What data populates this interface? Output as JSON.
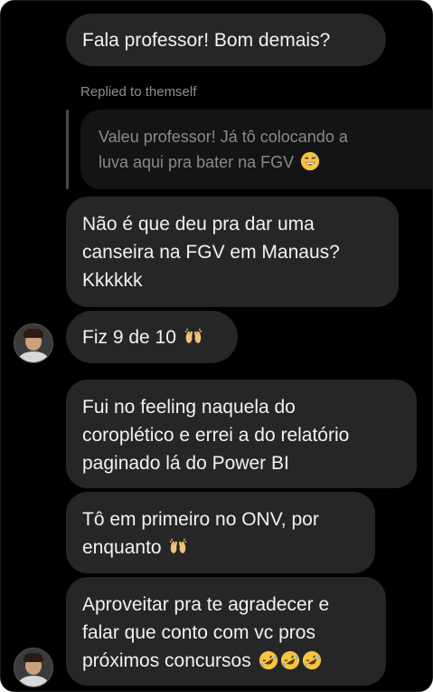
{
  "messages": [
    {
      "id": "m1",
      "lines": [
        "Fala professor! Bom demais?"
      ]
    },
    {
      "id": "reply",
      "label": "Replied to themself",
      "quoted_lines": [
        "Valeu professor! Já tô colocando a",
        "luva aqui pra bater na FGV"
      ],
      "emoji": "grinning-sweat"
    },
    {
      "id": "m2",
      "lines": [
        "Não é que deu pra dar uma",
        "canseira na FGV em Manaus?",
        "Kkkkkk"
      ]
    },
    {
      "id": "m3",
      "lines": [
        "Fiz 9 de 10"
      ],
      "emoji": "raising-hands"
    },
    {
      "id": "m4",
      "lines": [
        "Fui no feeling naquela do",
        "coroplético e errei a do relatório",
        "paginado lá do Power BI"
      ]
    },
    {
      "id": "m5",
      "lines": [
        "Tô em primeiro no ONV, por",
        "enquanto"
      ],
      "emoji": "raising-hands"
    },
    {
      "id": "m6",
      "lines": [
        "Aproveitar pra te agradecer e",
        "falar que conto com vc pros",
        "próximos concursos"
      ],
      "emoji": "rofl-x3"
    }
  ],
  "colors": {
    "background": "#000000",
    "bubble": "#262626",
    "text": "#f2f2f2",
    "muted": "#8e8e8e"
  }
}
